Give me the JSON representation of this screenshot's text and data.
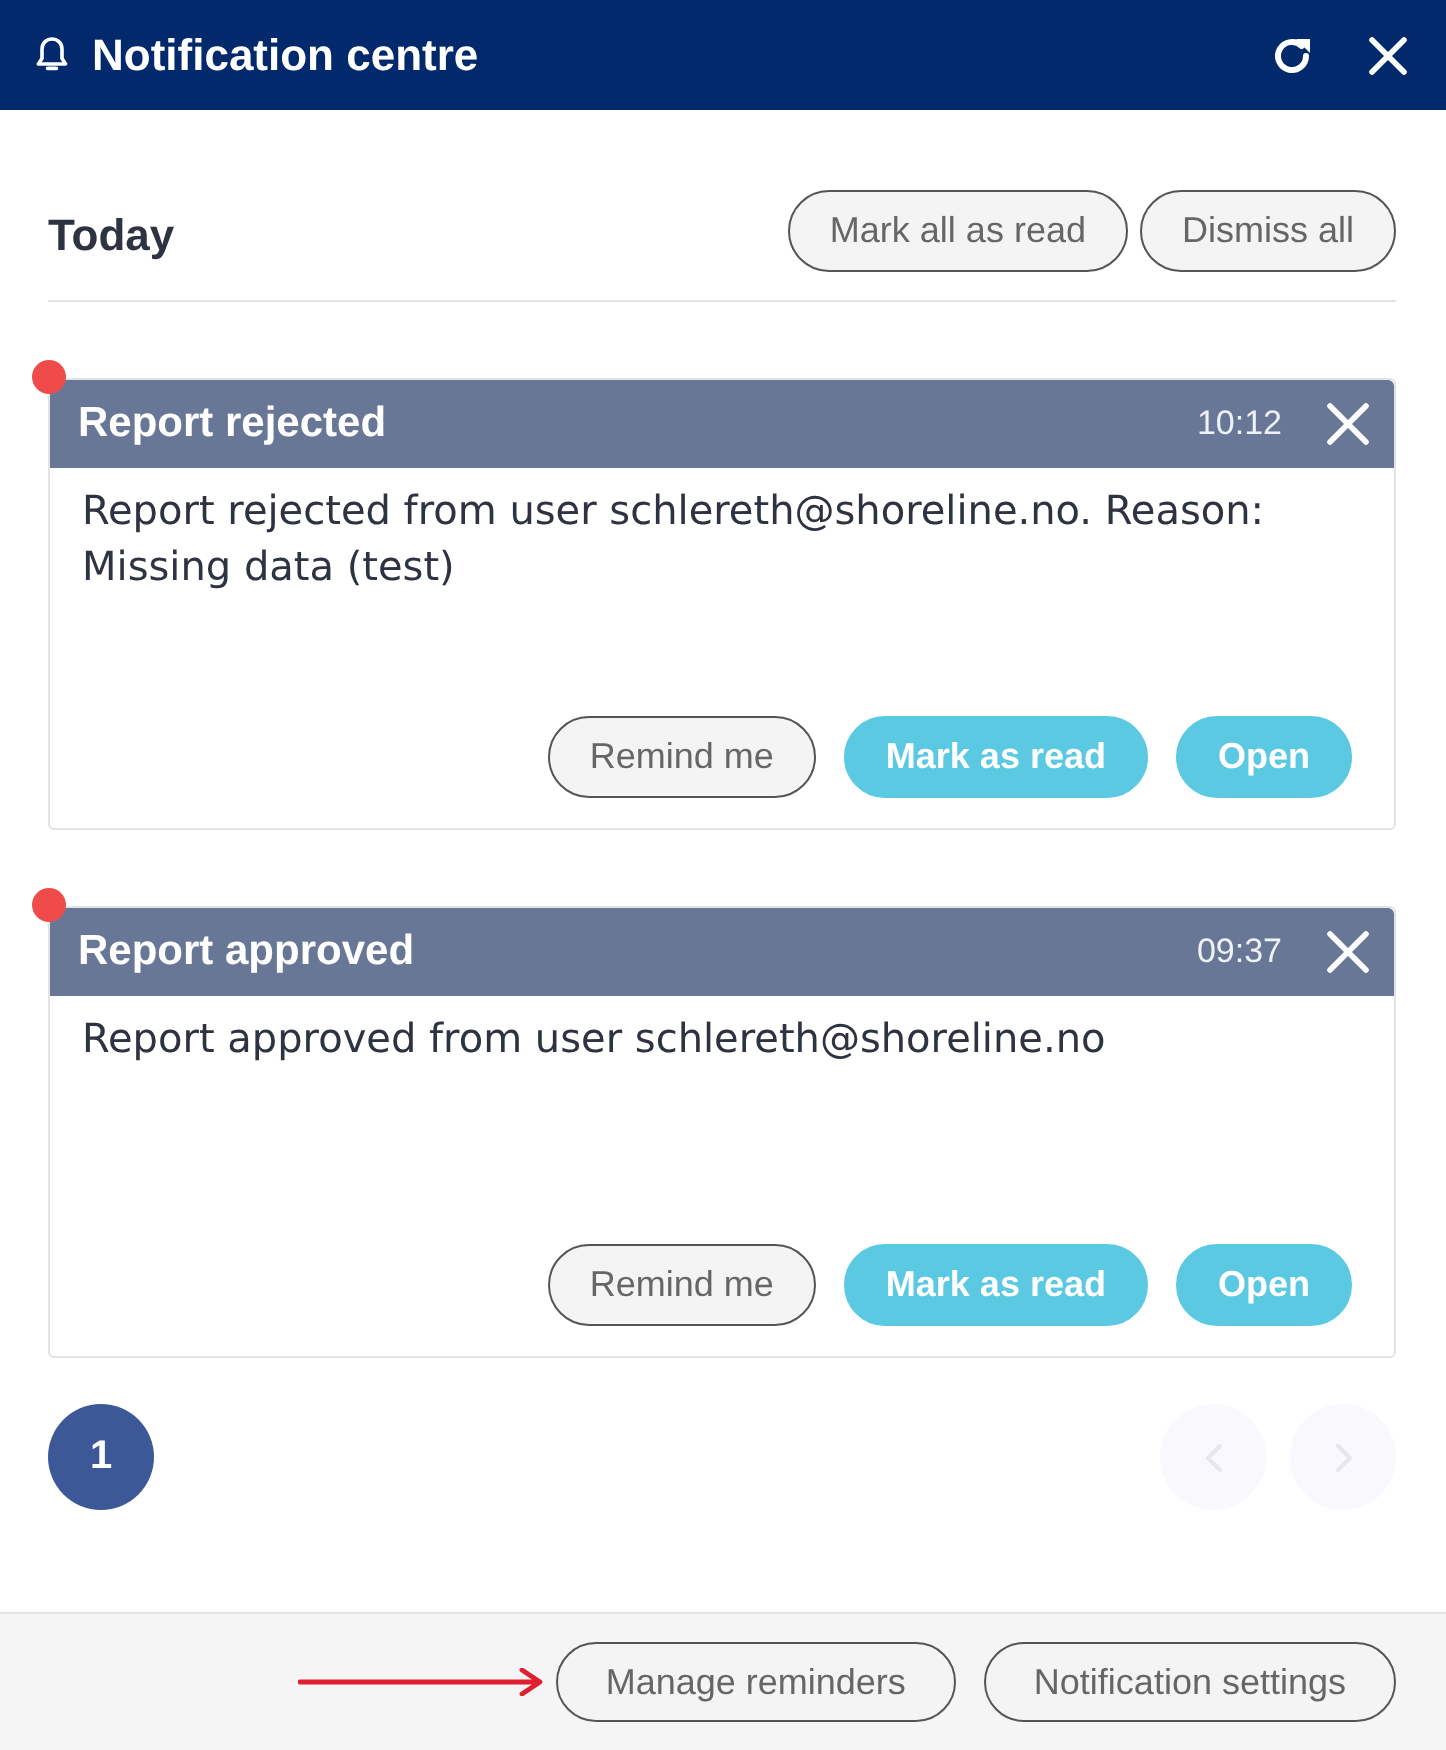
{
  "window": {
    "title": "Notification centre"
  },
  "section": {
    "title": "Today",
    "actions": [
      "Mark all as read",
      "Dismiss all"
    ]
  },
  "notifications": [
    {
      "title": "Report rejected",
      "time": "10:12",
      "unread": true,
      "message": "Report rejected from user schlereth@shoreline.no. Reason: Missing data (test)",
      "actions": [
        {
          "label": "Remind me",
          "kind": "secondary"
        },
        {
          "label": "Mark as read",
          "kind": "primary"
        },
        {
          "label": "Open",
          "kind": "primary"
        }
      ]
    },
    {
      "title": "Report approved",
      "time": "09:37",
      "unread": true,
      "message": "Report approved from user schlereth@shoreline.no",
      "actions": [
        {
          "label": "Remind me",
          "kind": "secondary"
        },
        {
          "label": "Mark as read",
          "kind": "primary"
        },
        {
          "label": "Open",
          "kind": "primary"
        }
      ]
    }
  ],
  "pagination": {
    "pages": [
      {
        "label": "1",
        "selected": true
      }
    ],
    "prev": {
      "disabled": true
    },
    "next": {
      "disabled": true
    }
  },
  "footer": {
    "buttons": [
      "Manage reminders",
      "Notification settings"
    ]
  }
}
